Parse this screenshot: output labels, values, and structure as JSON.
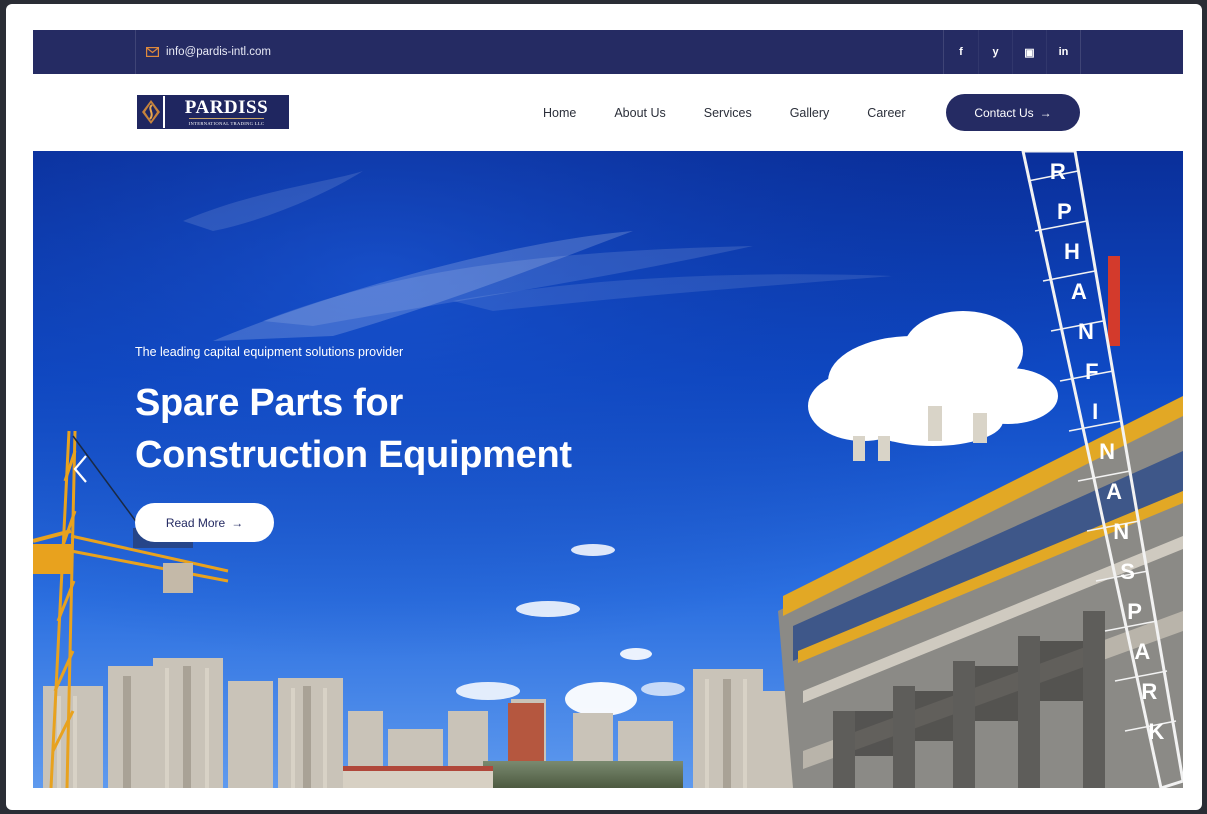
{
  "topbar": {
    "email": "info@pardis-intl.com",
    "email_icon": "envelope-icon",
    "socials": [
      {
        "label": "f",
        "icon": "facebook-icon"
      },
      {
        "label": "y",
        "icon": "twitter-icon"
      },
      {
        "label": "▣",
        "icon": "video-icon"
      },
      {
        "label": "in",
        "icon": "linkedin-icon"
      }
    ]
  },
  "header": {
    "logo": {
      "brand": "PARDISS",
      "sub": "INTERNATIONAL TRADING LLC"
    },
    "nav": [
      "Home",
      "About Us",
      "Services",
      "Gallery",
      "Career"
    ],
    "contact_label": "Contact Us",
    "contact_arrow": "→"
  },
  "hero": {
    "tagline": "The leading capital equipment solutions provider",
    "headline_line1": "Spare Parts for",
    "headline_line2": "Construction Equipment",
    "readmore_label": "Read More",
    "readmore_arrow": "→",
    "crane_text": "RPHANFINANSPARK"
  },
  "colors": {
    "navy": "#252b63",
    "sky": "#0e49c4",
    "white": "#ffffff"
  }
}
